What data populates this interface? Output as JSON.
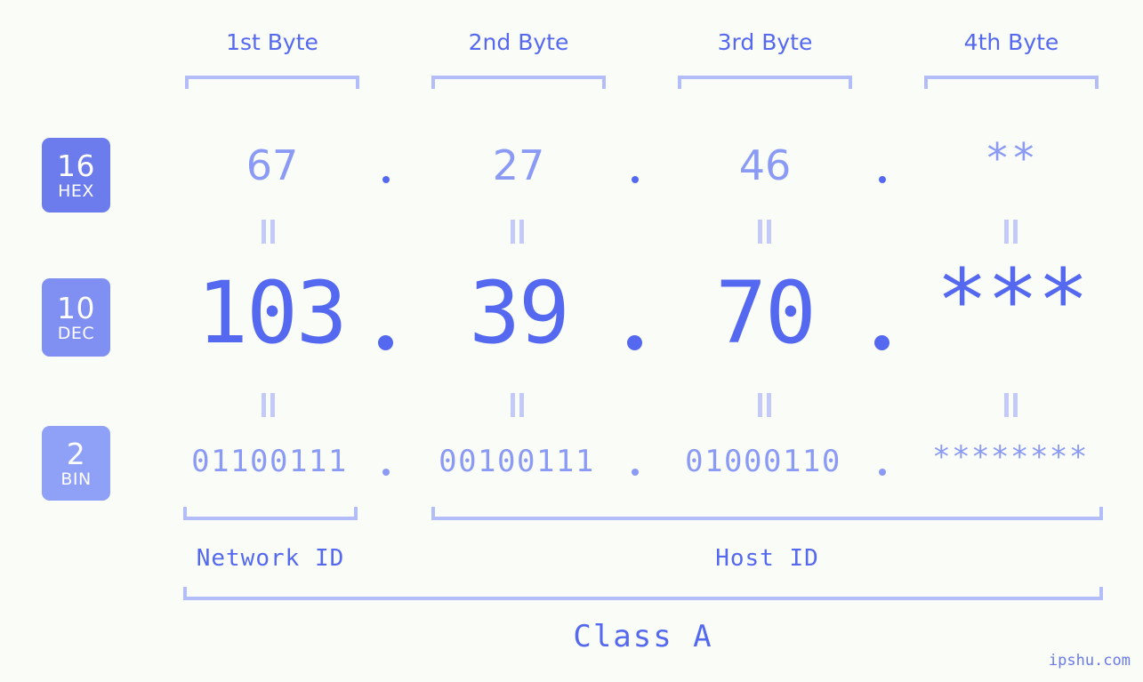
{
  "page": {
    "background_color": "#fafcf7",
    "accent_color": "#5468f0",
    "muted_accent_color": "#8a9af5",
    "bracket_color": "#b3bdfa",
    "watermark": "ipshu.com"
  },
  "byte_headers": [
    {
      "label": "1st Byte"
    },
    {
      "label": "2nd Byte"
    },
    {
      "label": "3rd Byte"
    },
    {
      "label": "4th Byte"
    }
  ],
  "bases": [
    {
      "number": "16",
      "name": "HEX",
      "color": "#6c7ced"
    },
    {
      "number": "10",
      "name": "DEC",
      "color": "#808ff2"
    },
    {
      "number": "2",
      "name": "BIN",
      "color": "#8fa0f7"
    }
  ],
  "rows": {
    "hex": {
      "base_number": "16",
      "base_name": "HEX",
      "values": [
        "67",
        "27",
        "46",
        "**"
      ],
      "separator": "."
    },
    "dec": {
      "base_number": "10",
      "base_name": "DEC",
      "values": [
        "103",
        "39",
        "70",
        "***"
      ],
      "separator": "."
    },
    "bin": {
      "base_number": "2",
      "base_name": "BIN",
      "values": [
        "01100111",
        "00100111",
        "01000110",
        "********"
      ],
      "separator": "."
    }
  },
  "equality_marks": {
    "symbol": "=",
    "count_per_row": 4
  },
  "segments": [
    {
      "label": "Network ID"
    },
    {
      "label": "Host ID"
    }
  ],
  "class": {
    "label": "Class A"
  }
}
